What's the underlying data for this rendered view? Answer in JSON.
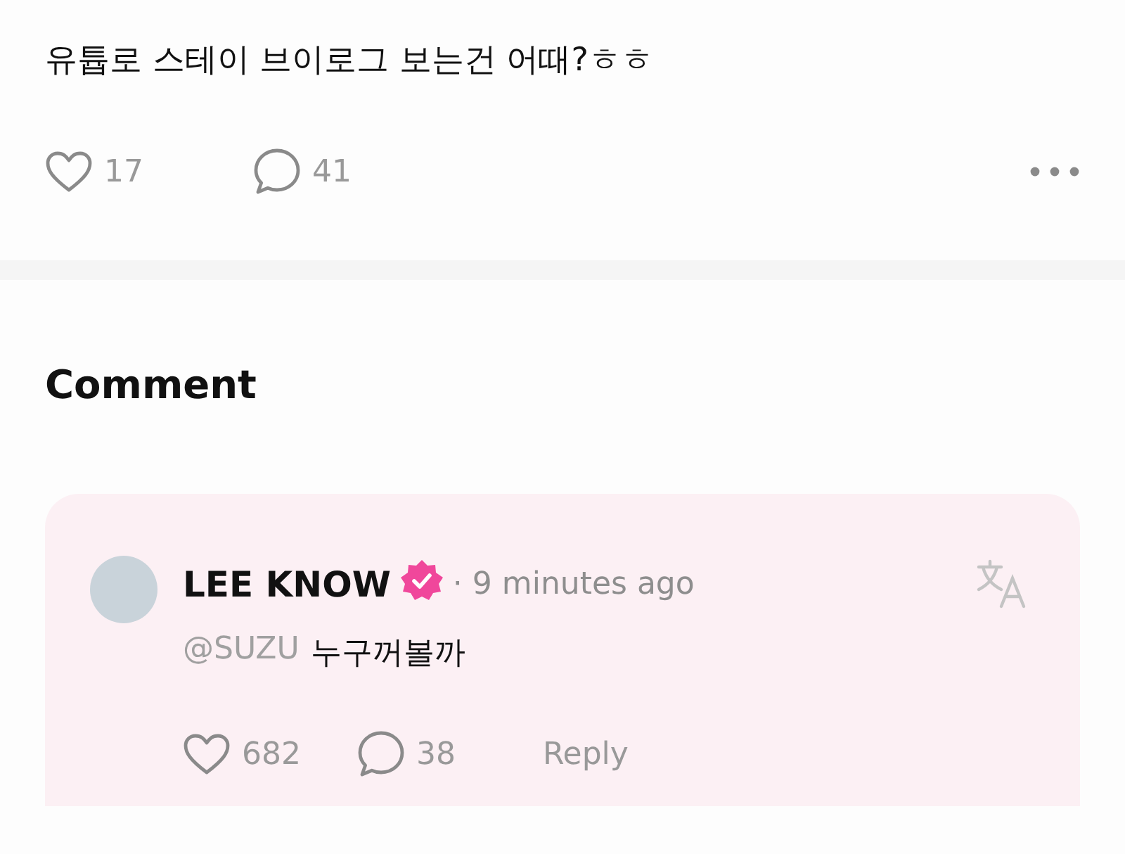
{
  "post": {
    "text": "유튭로 스테이 브이로그 보는건 어때?ㅎㅎ",
    "likes": "17",
    "comments": "41"
  },
  "comment_section": {
    "heading": "Comment"
  },
  "comments": [
    {
      "author": "LEE KNOW",
      "verified": true,
      "time": "· 9 minutes ago",
      "mention": "@SUZU",
      "text": "누구꺼볼까",
      "likes": "682",
      "replies": "38",
      "reply_label": "Reply"
    }
  ]
}
